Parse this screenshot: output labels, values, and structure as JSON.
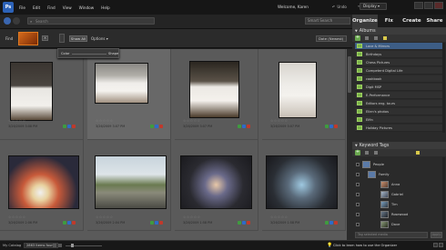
{
  "menu": {
    "logo": "Ps",
    "items": [
      "File",
      "Edit",
      "Find",
      "View",
      "Window",
      "Help"
    ],
    "welcome": "Welcome, Karen",
    "undo": "Undo",
    "redo": "Redo",
    "display": "Display ▾"
  },
  "toolbar": {
    "search_placeholder": "Search",
    "smart_search": "Smart Search"
  },
  "findbar": {
    "label": "Find",
    "show_all": "Show All",
    "options": "Options ▾",
    "sort": "Date (Newest)"
  },
  "options_panel": {
    "left_label": "Color",
    "right_label": "Shape"
  },
  "photos": [
    {
      "id": "p1",
      "stars": "☆☆☆☆☆",
      "date": "3/26/2009 3:08 PM"
    },
    {
      "id": "p2",
      "stars": "☆☆☆☆☆",
      "date": "3/26/2009 3:07 PM"
    },
    {
      "id": "p3",
      "stars": "☆☆☆☆☆",
      "date": "3/26/2009 3:07 PM"
    },
    {
      "id": "p4",
      "stars": "☆☆☆☆☆",
      "date": "3/26/2009 3:07 PM"
    },
    {
      "id": "p5",
      "stars": "☆☆☆☆☆",
      "date": "3/26/2009 2:06 PM"
    },
    {
      "id": "p6",
      "stars": "☆☆☆☆☆",
      "date": "3/26/2009 2:04 PM"
    },
    {
      "id": "p7",
      "stars": "☆☆☆☆☆",
      "date": "3/26/2009 1:58 PM"
    },
    {
      "id": "p8",
      "stars": "☆☆☆☆☆",
      "date": "3/26/2009 1:58 PM"
    }
  ],
  "panel": {
    "tabs": [
      "Organize",
      "Fix",
      "Create",
      "Share"
    ],
    "albums_title": "Albums",
    "albums": [
      "Lace & Mirrors",
      "Birthdays",
      "Chess Pictures",
      "Competent Digital Life",
      "cookbook",
      "Digit MSP",
      "E-Performance",
      "Editors eng. tours",
      "Ellen's photos",
      "Elfin",
      "Holiday Pictures"
    ],
    "keywords_title": "Keyword Tags",
    "keywords": [
      {
        "label": "People",
        "level": 0
      },
      {
        "label": "Family",
        "level": 1
      },
      {
        "label": "Anna",
        "level": 2
      },
      {
        "label": "Gabriel",
        "level": 2
      },
      {
        "label": "Tim",
        "level": 2
      },
      {
        "label": "Rosewood",
        "level": 2
      },
      {
        "label": "Dave",
        "level": 2
      }
    ],
    "tag_search_placeholder": "Tag selected media",
    "apply_label": "Apply"
  },
  "status": {
    "catalog": "My Catalog",
    "count": "2863 Items found",
    "learn": "Click to learn how to use the Organizer"
  },
  "colors": {
    "accent": "#3a66b0",
    "album_icon": "#7bb348",
    "tag_red": "#c0392b",
    "tag_blue": "#2e6bc9",
    "tag_green": "#3f9b3f"
  }
}
